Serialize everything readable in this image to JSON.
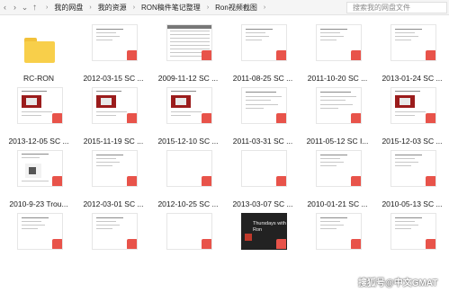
{
  "toolbar": {
    "back_icon": "‹",
    "forward_icon": "›",
    "dropdown_icon": "⌄",
    "up_icon": "↑",
    "breadcrumb": [
      "我的网盘",
      "我的资源",
      "RON稿件笔记整理",
      "Ron视频截图"
    ],
    "search_placeholder": "搜索我的网盘文件"
  },
  "pdf_badge": "",
  "items": [
    {
      "label": "RC-RON",
      "type": "folder"
    },
    {
      "label": "2012-03-15 SC ...",
      "type": "pdf"
    },
    {
      "label": "2009-11-12 SC ...",
      "type": "pdf"
    },
    {
      "label": "2011-08-25 SC ...",
      "type": "pdf"
    },
    {
      "label": "2011-10-20 SC ...",
      "type": "pdf"
    },
    {
      "label": "2013-01-24 SC ...",
      "type": "pdf"
    },
    {
      "label": "2013-12-05 SC ...",
      "type": "pdf"
    },
    {
      "label": "2015-11-19 SC ...",
      "type": "pdf"
    },
    {
      "label": "2015-12-10 SC ...",
      "type": "pdf"
    },
    {
      "label": "2011-03-31 SC ...",
      "type": "pdf"
    },
    {
      "label": "2011-05-12 SC I...",
      "type": "pdf"
    },
    {
      "label": "2015-12-03 SC ...",
      "type": "pdf"
    },
    {
      "label": "2010-9-23 Trou...",
      "type": "pdf"
    },
    {
      "label": "2012-03-01 SC ...",
      "type": "pdf"
    },
    {
      "label": "2012-10-25 SC ...",
      "type": "pdf"
    },
    {
      "label": "2013-03-07 SC ...",
      "type": "pdf"
    },
    {
      "label": "2010-01-21 SC ...",
      "type": "pdf"
    },
    {
      "label": "2010-05-13 SC ...",
      "type": "pdf"
    },
    {
      "label": "",
      "type": "pdf"
    },
    {
      "label": "",
      "type": "pdf"
    },
    {
      "label": "",
      "type": "pdf"
    },
    {
      "label": "",
      "type": "pdf"
    },
    {
      "label": "",
      "type": "pdf"
    },
    {
      "label": "",
      "type": "pdf"
    }
  ],
  "thumb_texts": {
    "thursdays_line1": "Thursdays with",
    "thursdays_line2": "Ron"
  },
  "watermark": "搜狐号@中文GMAT",
  "colors": {
    "folder": "#f8cf4a",
    "pdf_badge": "#e8534a",
    "skull_bg": "#9b1c1c"
  }
}
